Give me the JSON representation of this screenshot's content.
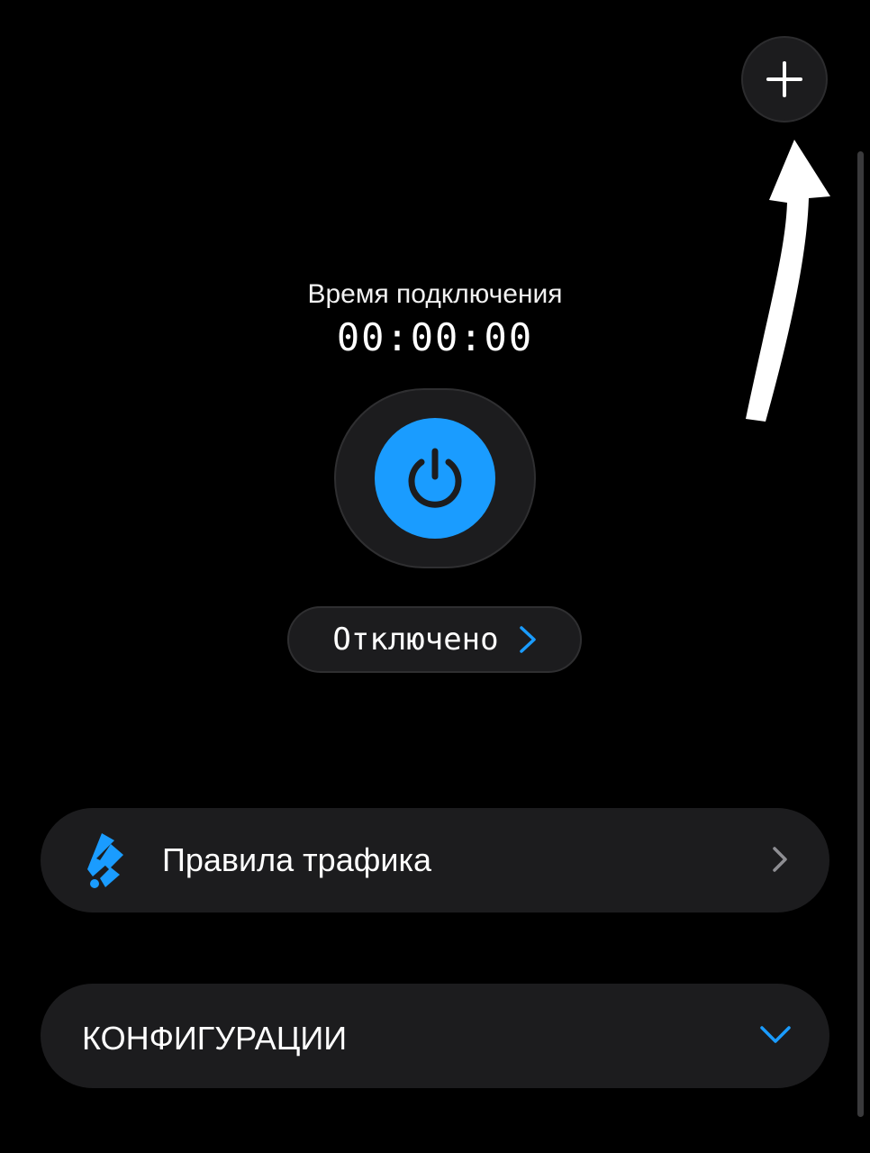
{
  "header": {
    "add_icon": "plus-icon"
  },
  "timer": {
    "label": "Время подключения",
    "value": "00:00:00"
  },
  "connection": {
    "power_icon": "power-icon",
    "status_label": "Отключено",
    "accent_color": "#1a9cff"
  },
  "rules": {
    "label": "Правила трафика",
    "icon": "traffic-rules-icon"
  },
  "configurations": {
    "label": "КОНФИГУРАЦИИ",
    "icon": "chevron-down-icon"
  }
}
